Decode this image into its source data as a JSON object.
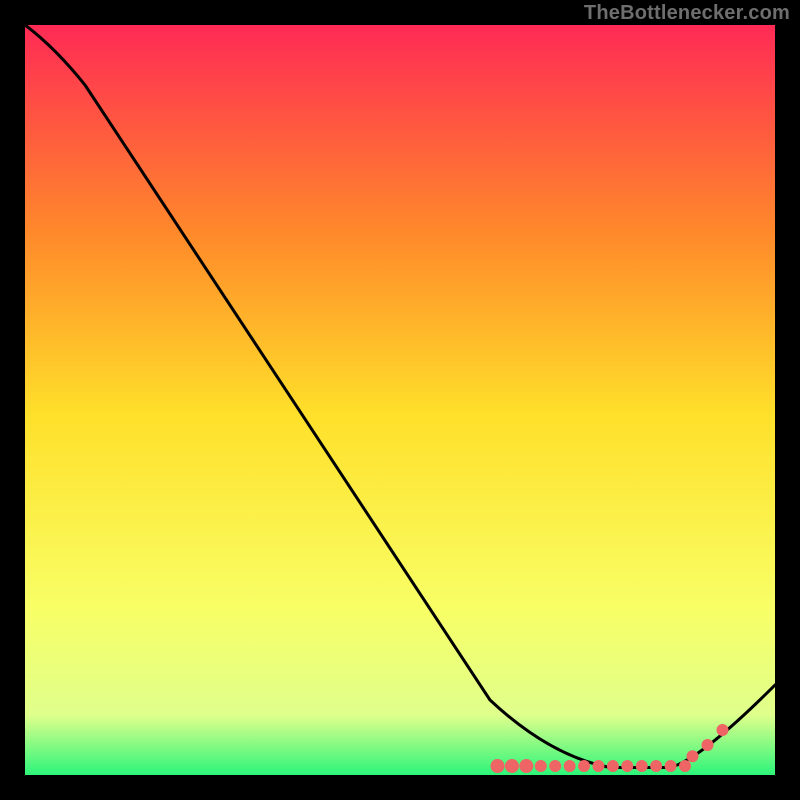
{
  "watermark": {
    "text": "TheBottlenecker.com"
  },
  "colors": {
    "background": "#000000",
    "gradient_top": "#ff2a55",
    "gradient_mid_upper": "#ff8a2a",
    "gradient_mid": "#ffe02a",
    "gradient_mid_lower": "#f8ff66",
    "gradient_low": "#dfff8c",
    "gradient_bottom": "#2cf57a",
    "line": "#000000",
    "marker": "#ef6464"
  },
  "chart_data": {
    "type": "line",
    "title": "",
    "xlabel": "",
    "ylabel": "",
    "xlim": [
      0,
      100
    ],
    "ylim": [
      0,
      100
    ],
    "curve": [
      {
        "x": 0,
        "y": 100
      },
      {
        "x": 8,
        "y": 92
      },
      {
        "x": 62,
        "y": 10
      },
      {
        "x": 70,
        "y": 2.5
      },
      {
        "x": 78,
        "y": 1.0
      },
      {
        "x": 86,
        "y": 1.0
      },
      {
        "x": 90,
        "y": 2.0
      },
      {
        "x": 100,
        "y": 12
      }
    ],
    "marker_cluster": {
      "x_range": [
        63,
        88
      ],
      "y": 1.2,
      "count_dense": 14
    },
    "marker_outliers": [
      {
        "x": 89,
        "y": 2.5
      },
      {
        "x": 91,
        "y": 4.0
      },
      {
        "x": 93,
        "y": 6.0
      }
    ]
  }
}
